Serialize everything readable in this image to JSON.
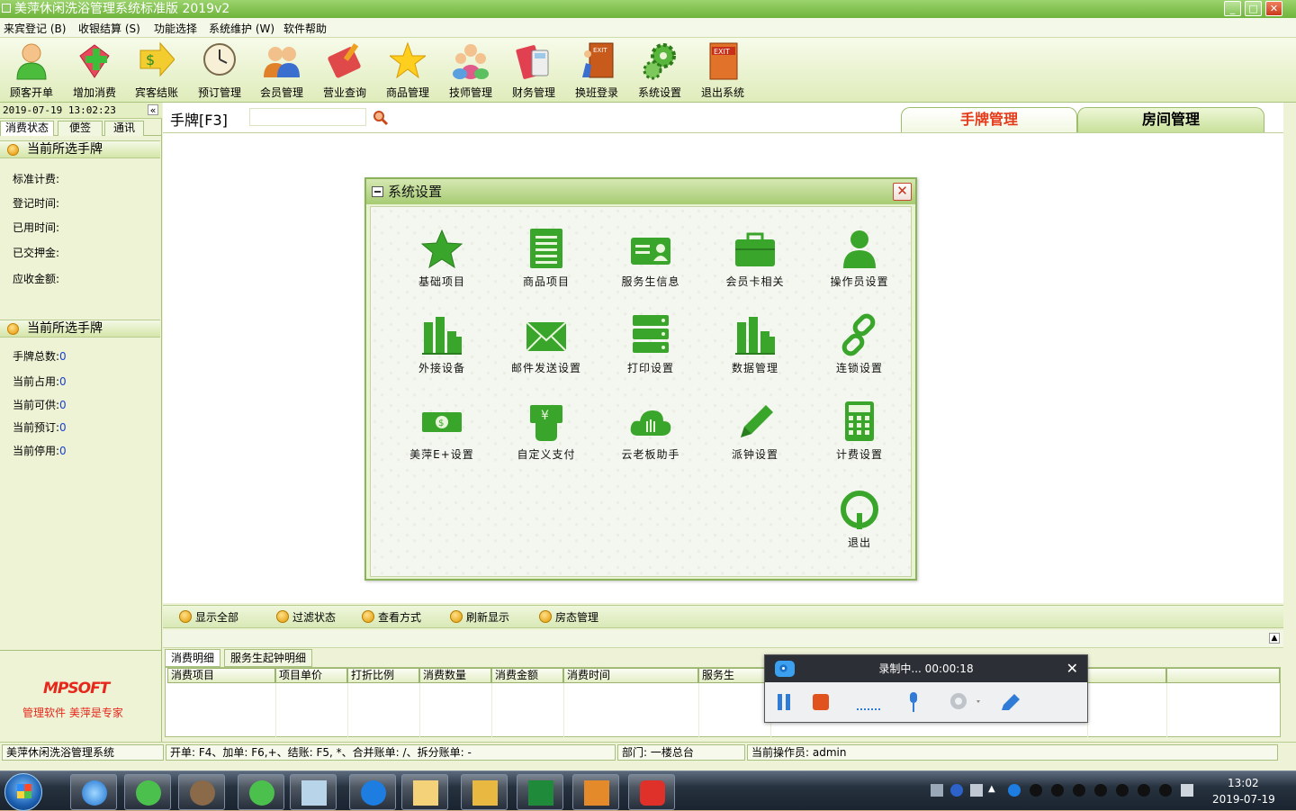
{
  "window": {
    "title": "美萍休闲洗浴管理系统标准版 2019v2"
  },
  "menu": [
    "来宾登记 (B)",
    "收银结算 (S)",
    "功能选择",
    "系统维护 (W)",
    "软件帮助"
  ],
  "toolbar": [
    {
      "label": "顾客开单",
      "icon": "customer-icon"
    },
    {
      "label": "增加消费",
      "icon": "add-consume-icon"
    },
    {
      "label": "宾客结账",
      "icon": "checkout-icon"
    },
    {
      "label": "预订管理",
      "icon": "clock-icon"
    },
    {
      "label": "会员管理",
      "icon": "members-icon"
    },
    {
      "label": "营业查询",
      "icon": "ticket-icon"
    },
    {
      "label": "商品管理",
      "icon": "star-icon"
    },
    {
      "label": "技师管理",
      "icon": "people-icon"
    },
    {
      "label": "财务管理",
      "icon": "calculator-icon"
    },
    {
      "label": "换班登录",
      "icon": "exit-door-icon"
    },
    {
      "label": "系统设置",
      "icon": "gears-icon"
    },
    {
      "label": "退出系统",
      "icon": "exit-icon"
    }
  ],
  "left": {
    "datetime": "2019-07-19 13:02:23",
    "tabs": [
      "消费状态",
      "便签",
      "通讯"
    ],
    "section1_title": "当前所选手牌",
    "fields1": [
      "标准计费:",
      "登记时间:",
      "已用时间:",
      "已交押金:",
      "应收金额:"
    ],
    "section2_title": "当前所选手牌",
    "fields2": [
      {
        "label": "手牌总数:",
        "value": "0"
      },
      {
        "label": "当前占用:",
        "value": "0"
      },
      {
        "label": "当前可供:",
        "value": "0"
      },
      {
        "label": "当前预订:",
        "value": "0"
      },
      {
        "label": "当前停用:",
        "value": "0"
      }
    ],
    "logo_text": "MPSOFT",
    "slogan": "管理软件  美萍是专家"
  },
  "search": {
    "label": "手牌[F3]",
    "value": ""
  },
  "main_tabs": [
    "手牌管理",
    "房间管理"
  ],
  "filter_buttons": [
    "显示全部",
    "过滤状态",
    "查看方式",
    "刷新显示",
    "房态管理"
  ],
  "bottom_tabs": [
    "消费明细",
    "服务生起钟明细"
  ],
  "grid_columns": [
    "消费项目",
    "项目单价",
    "打折比例",
    "消费数量",
    "消费金额",
    "消费时间",
    "服务生",
    "",
    "",
    ""
  ],
  "status": [
    "美萍休闲洗浴管理系统",
    "开单: F4、加单: F6,+、结账: F5, *、合并账单: /、拆分账单: -",
    "部门: 一楼总台",
    "当前操作员: admin"
  ],
  "dialog": {
    "title": "系统设置",
    "items": [
      {
        "label": "基础项目",
        "icon": "star-icon"
      },
      {
        "label": "商品项目",
        "icon": "list-icon"
      },
      {
        "label": "服务生信息",
        "icon": "id-card-icon"
      },
      {
        "label": "会员卡相关",
        "icon": "briefcase-icon"
      },
      {
        "label": "操作员设置",
        "icon": "user-icon"
      },
      {
        "label": "外接设备",
        "icon": "bar-chart-icon"
      },
      {
        "label": "邮件发送设置",
        "icon": "envelope-icon"
      },
      {
        "label": "打印设置",
        "icon": "server-icon"
      },
      {
        "label": "数据管理",
        "icon": "bar-chart-icon"
      },
      {
        "label": "连锁设置",
        "icon": "link-icon"
      },
      {
        "label": "美萍E+设置",
        "icon": "money-icon"
      },
      {
        "label": "自定义支付",
        "icon": "payment-hand-icon"
      },
      {
        "label": "云老板助手",
        "icon": "cloud-icon"
      },
      {
        "label": "派钟设置",
        "icon": "pencil-icon"
      },
      {
        "label": "计费设置",
        "icon": "calculator-icon"
      },
      {
        "label": "退出",
        "icon": "power-icon"
      }
    ]
  },
  "recorder": {
    "status": "录制中... 00:00:18"
  },
  "taskbar": {
    "time": "13:02",
    "date": "2019-07-19"
  }
}
